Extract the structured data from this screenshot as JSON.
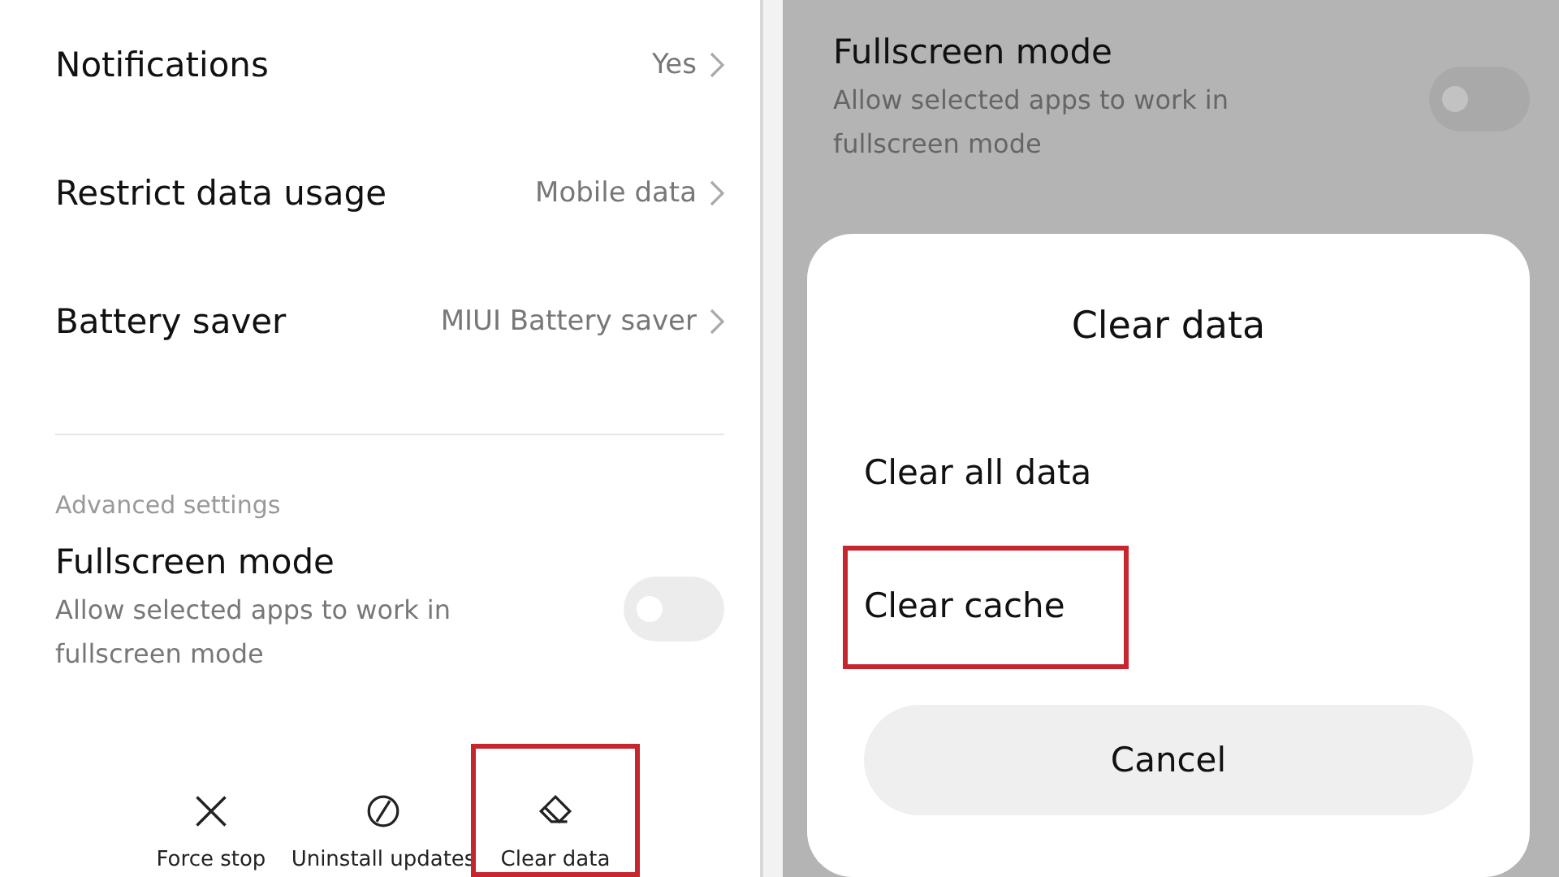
{
  "left_screen": {
    "rows": [
      {
        "label": "Notifications",
        "value": "Yes"
      },
      {
        "label": "Restrict data usage",
        "value": "Mobile data"
      },
      {
        "label": "Battery saver",
        "value": "MIUI Battery saver"
      }
    ],
    "section_title": "Advanced settings",
    "fullscreen": {
      "title": "Fullscreen mode",
      "description": "Allow selected apps to work in fullscreen mode",
      "on": false
    },
    "actions": [
      {
        "kind": "close",
        "label": "Force stop",
        "highlighted": false
      },
      {
        "kind": "block",
        "label": "Uninstall updates",
        "highlighted": false
      },
      {
        "kind": "eraser",
        "label": "Clear data",
        "highlighted": true
      }
    ]
  },
  "right_screen": {
    "fullscreen": {
      "title": "Fullscreen mode",
      "description": "Allow selected apps to work in fullscreen mode",
      "on": false
    },
    "dialog": {
      "title": "Clear data",
      "options": [
        {
          "label": "Clear all data",
          "highlighted": false
        },
        {
          "label": "Clear cache",
          "highlighted": true
        }
      ],
      "cancel": "Cancel"
    }
  }
}
